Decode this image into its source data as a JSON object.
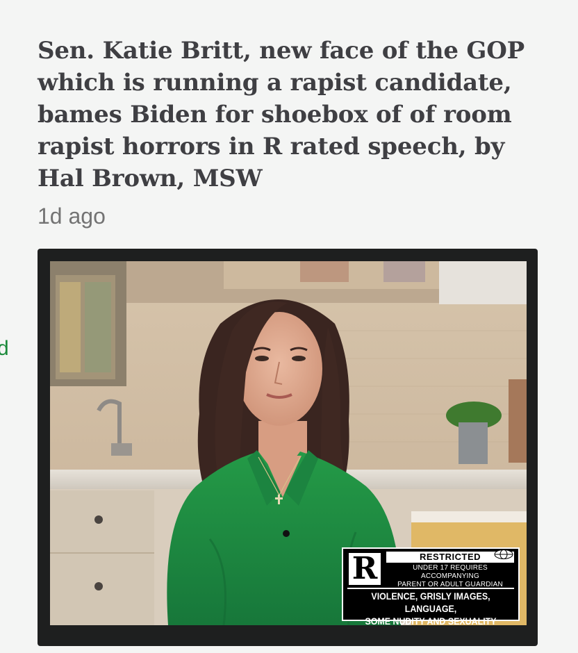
{
  "article": {
    "headline": "Sen. Katie Britt, new face of the GOP which is running a rapist candidate, bames Biden for shoebox of of room rapist horrors in R rated speech, by Hal Brown, MSW",
    "timestamp": "1d ago"
  },
  "side_mark": "d",
  "rating_badge": {
    "letter": "R",
    "label": "RESTRICTED",
    "requirement_line1": "UNDER 17 REQUIRES ACCOMPANYING",
    "requirement_line2": "PARENT OR ADULT GUARDIAN",
    "reason_line1": "VIOLENCE, GRISLY IMAGES, LANGUAGE,",
    "reason_line2": "SOME NUDITY AND SEXUALITY"
  },
  "colors": {
    "page_background": "#f4f5f4",
    "headline_text": "#3f3f43",
    "timestamp_text": "#737373",
    "side_mark": "#1a8a3a",
    "frame": "#1e1f1f",
    "jacket_green": "#1f8a3e"
  }
}
